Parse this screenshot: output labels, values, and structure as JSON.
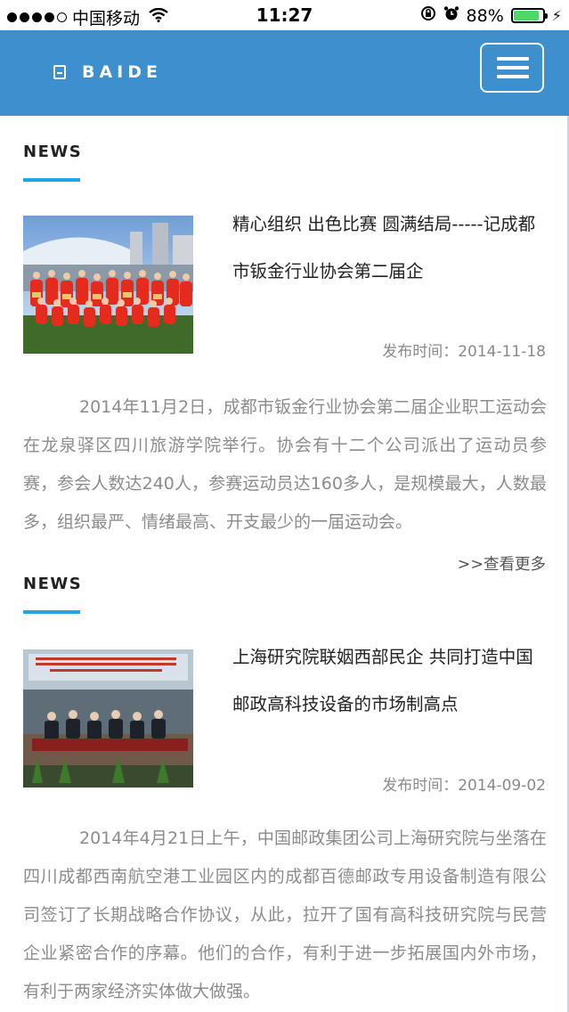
{
  "status_bar": {
    "carrier": "中国移动",
    "time": "11:27",
    "battery_percent": "88%",
    "battery_level": 0.88,
    "icons": [
      "signal-dots",
      "wifi-icon",
      "rotation-lock-icon",
      "alarm-icon",
      "battery-icon",
      "charging-icon"
    ]
  },
  "header": {
    "logo_text": "BAIDE",
    "background_color": "#3d8fcd",
    "menu_icon": "hamburger-menu-icon"
  },
  "news": [
    {
      "section_label": "NEWS",
      "title": "精心组织 出色比赛 圆满结局-----记成都市钣金行业协会第二届企",
      "date": "发布时间：2014-11-18",
      "body": "2014年11月2日，成都市钣金行业协会第二届企业职工运动会在龙泉驿区四川旅游学院举行。协会有十二个公司派出了运动员参赛，参会人数达240人，参赛运动员达160多人，是规模最大，人数最多，组织最严、情绪最高、开支最少的一届运动会。",
      "more": ">>查看更多"
    },
    {
      "section_label": "NEWS",
      "title": "上海研究院联姻西部民企 共同打造中国邮政高科技设备的市场制高点",
      "date": "发布时间：2014-09-02",
      "body": "2014年4月21日上午，中国邮政集团公司上海研究院与坐落在四川成都西南航空港工业园区内的成都百德邮政专用设备制造有限公司签订了长期战略合作协议，从此，拉开了国有高科技研究院与民营企业紧密合作的序幕。他们的合作，有利于进一步拓展国内外市场，有利于两家经济实体做大做强。"
    }
  ],
  "colors": {
    "accent_line": "#1fa6e6",
    "body_text": "#8c8c8c"
  }
}
